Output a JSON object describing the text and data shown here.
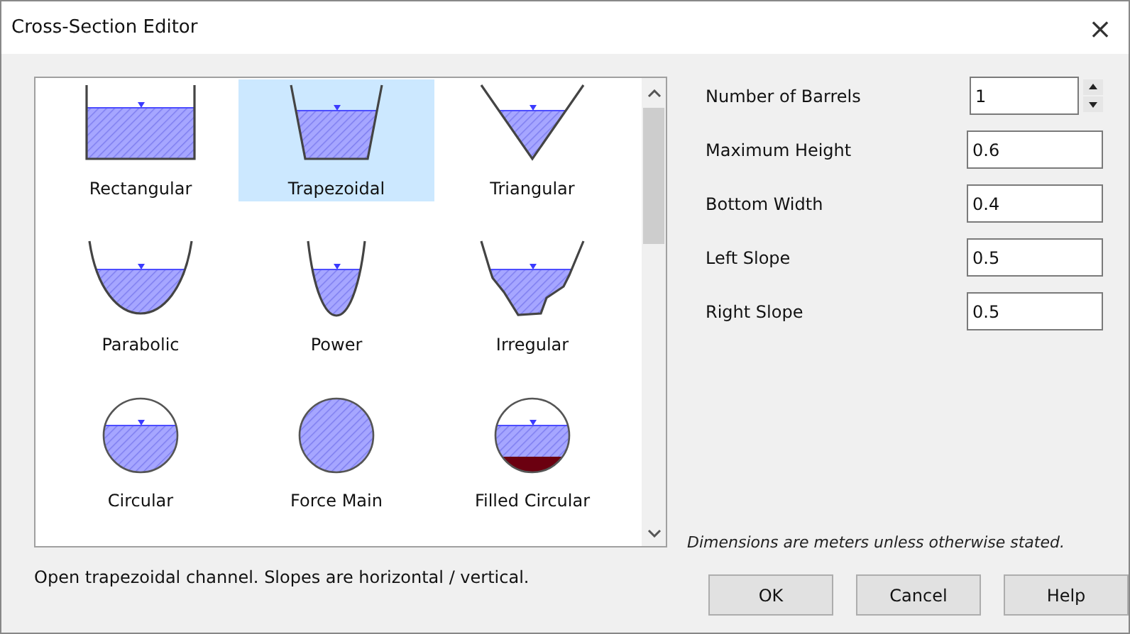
{
  "window": {
    "title": "Cross-Section Editor",
    "close": "×"
  },
  "shapes": [
    {
      "label": "Rectangular",
      "kind": "rectangular",
      "selected": false
    },
    {
      "label": "Trapezoidal",
      "kind": "trapezoidal",
      "selected": true
    },
    {
      "label": "Triangular",
      "kind": "triangular",
      "selected": false
    },
    {
      "label": "Parabolic",
      "kind": "parabolic",
      "selected": false
    },
    {
      "label": "Power",
      "kind": "power",
      "selected": false
    },
    {
      "label": "Irregular",
      "kind": "irregular",
      "selected": false
    },
    {
      "label": "Circular",
      "kind": "circular",
      "selected": false
    },
    {
      "label": "Force Main",
      "kind": "force_main",
      "selected": false
    },
    {
      "label": "Filled Circular",
      "kind": "filled_circular",
      "selected": false
    }
  ],
  "description": "Open trapezoidal channel. Slopes are horizontal / vertical.",
  "fields": [
    {
      "label": "Number of Barrels",
      "value": "1",
      "kind": "spinner"
    },
    {
      "label": "Maximum Height",
      "value": "0.6",
      "kind": "text"
    },
    {
      "label": "Bottom Width",
      "value": "0.4",
      "kind": "text"
    },
    {
      "label": "Left Slope",
      "value": "0.5",
      "kind": "text"
    },
    {
      "label": "Right Slope",
      "value": "0.5",
      "kind": "text"
    }
  ],
  "note": "Dimensions are meters unless otherwise stated.",
  "buttons": [
    "OK",
    "Cancel",
    "Help"
  ]
}
